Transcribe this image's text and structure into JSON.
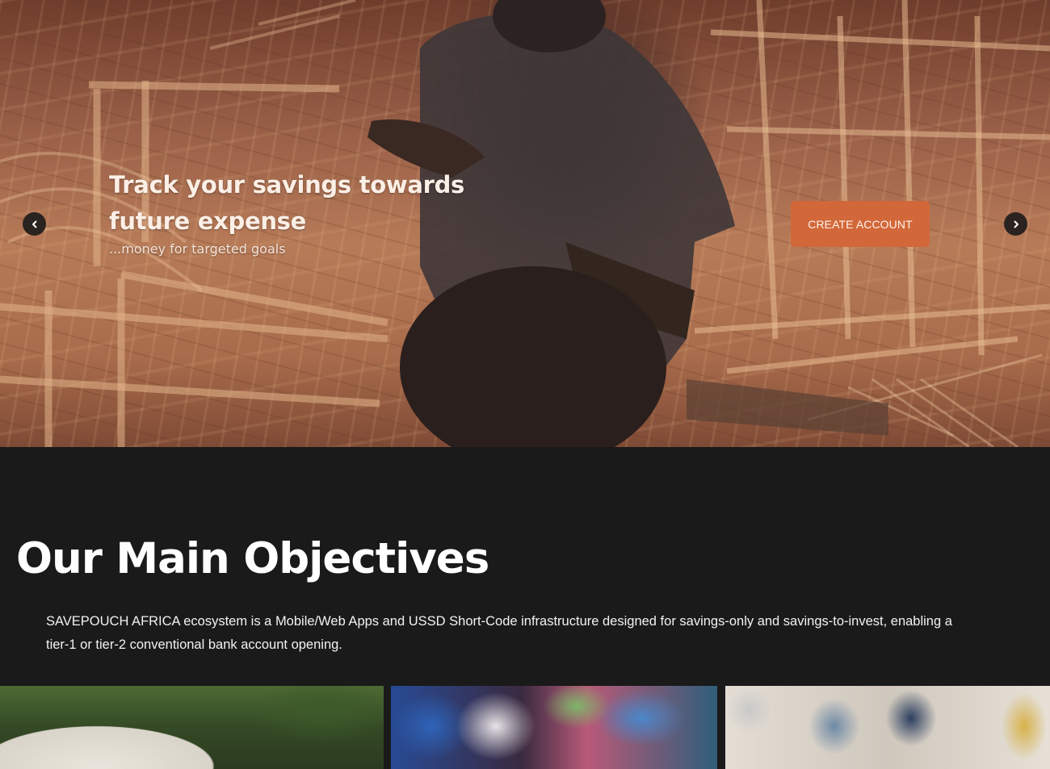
{
  "hero": {
    "title": "Track your savings towards future expense",
    "subtitle": "...money for targeted goals",
    "cta_label": "CREATE ACCOUNT",
    "prev_icon": "chevron-left-icon",
    "next_icon": "chevron-right-icon",
    "accent_color": "#d2683a"
  },
  "objectives": {
    "title": "Our Main Objectives",
    "description": "SAVEPOUCH AFRICA ecosystem is a Mobile/Web Apps and USSD Short-Code infrastructure designed for savings-only and savings-to-invest, enabling a tier-1 or tier-2 conventional bank account opening."
  },
  "gallery": {
    "tiles": [
      "image",
      "image",
      "image"
    ]
  }
}
